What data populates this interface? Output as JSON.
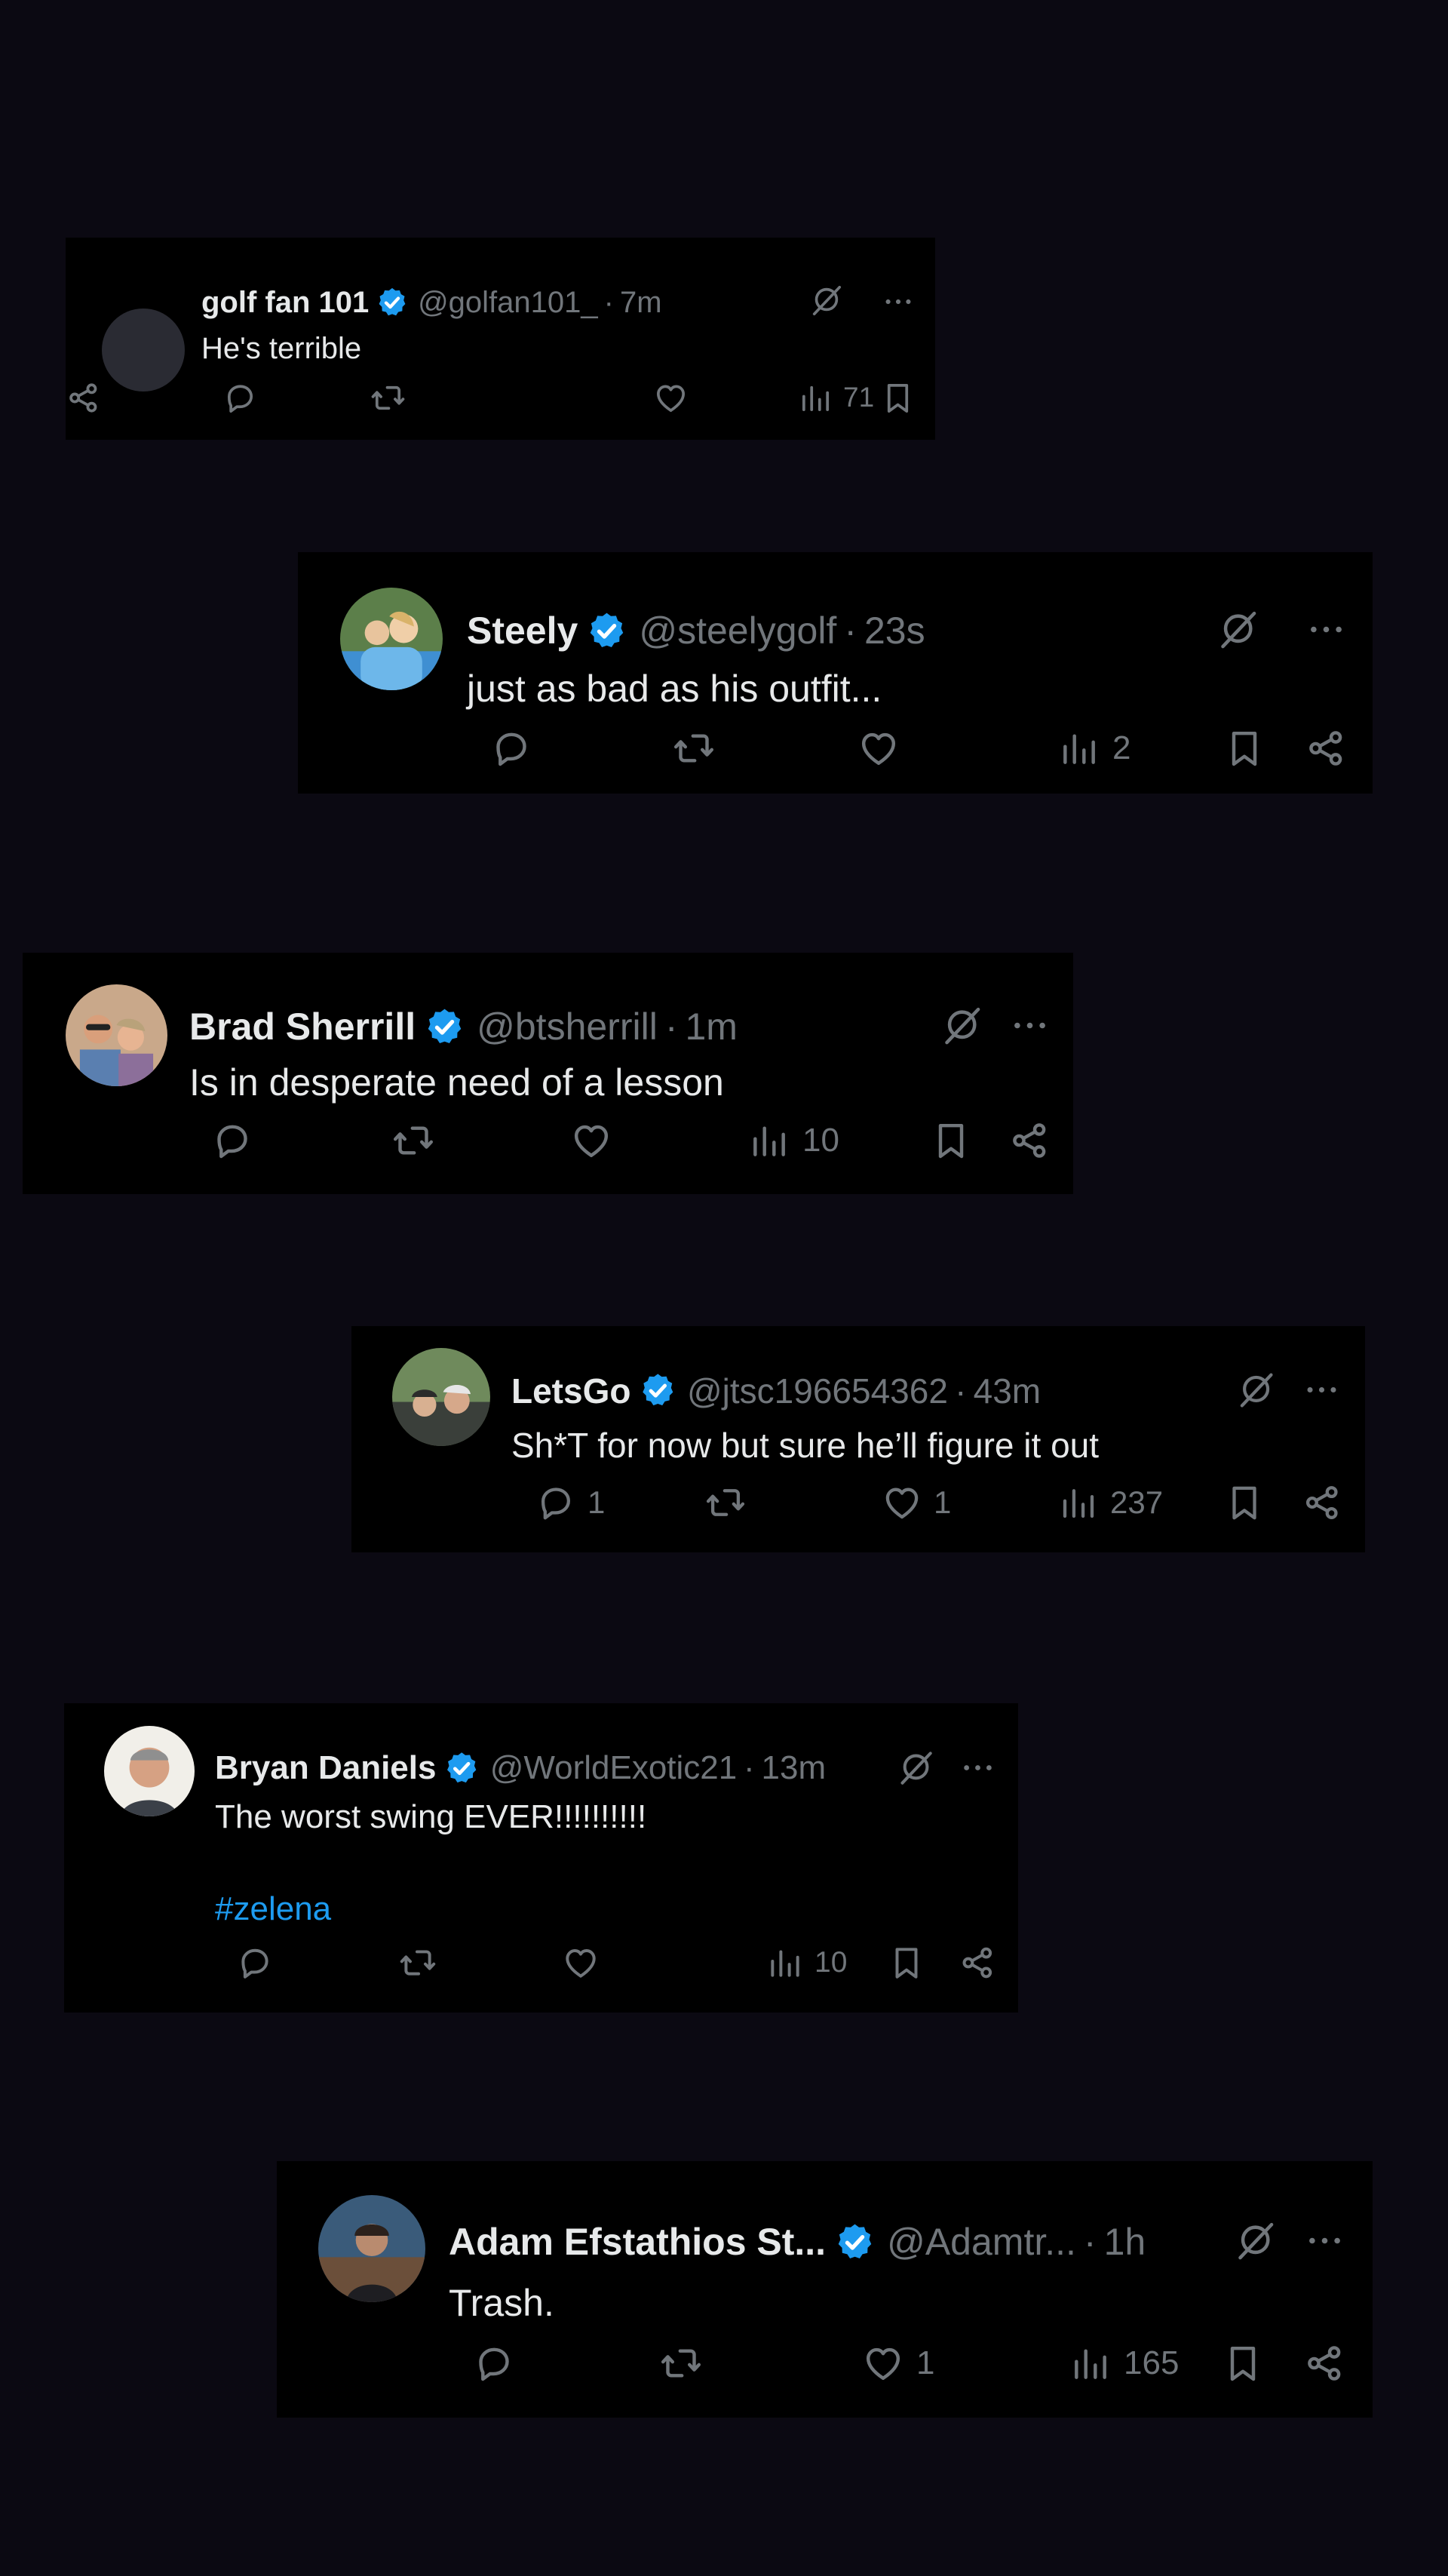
{
  "tweets": [
    {
      "name": "golf fan 101",
      "handle": "@golfan101_",
      "time": "7m",
      "text": "He's terrible",
      "hashtag": "",
      "replies": "",
      "likes": "",
      "views": "71"
    },
    {
      "name": "Steely",
      "handle": "@steelygolf",
      "time": "23s",
      "text": "just as bad as his outfit...",
      "hashtag": "",
      "replies": "",
      "likes": "",
      "views": "2"
    },
    {
      "name": "Brad Sherrill",
      "handle": "@btsherrill",
      "time": "1m",
      "text": "Is in desperate need of a lesson",
      "hashtag": "",
      "replies": "",
      "likes": "",
      "views": "10"
    },
    {
      "name": "LetsGo",
      "handle": "@jtsc196654362",
      "time": "43m",
      "text": "Sh*T for now but sure he’ll figure it out",
      "hashtag": "",
      "replies": "1",
      "likes": "1",
      "views": "237"
    },
    {
      "name": "Bryan Daniels",
      "handle": "@WorldExotic21",
      "time": "13m",
      "text": "The worst swing EVER!!!!!!!!!!",
      "hashtag": "#zelena",
      "replies": "",
      "likes": "",
      "views": "10"
    },
    {
      "name": "Adam Efstathios St...",
      "handle": "@Adamtr...",
      "time": "1h",
      "text": "Trash.",
      "hashtag": "",
      "replies": "",
      "likes": "1",
      "views": "165"
    }
  ],
  "separator": "·",
  "icons": {
    "verified": "verified-badge-icon",
    "topic": "grok-slash-icon",
    "more": "more-dots-icon",
    "reply": "reply-icon",
    "retweet": "retweet-icon",
    "like": "like-icon",
    "views": "views-icon",
    "bookmark": "bookmark-icon",
    "share": "share-icon"
  },
  "colors": {
    "background": "#0b0912",
    "card": "#000000",
    "verified": "#1d9bf0",
    "hashtag": "#1d9bf0",
    "muted": "#71767b",
    "text": "#e7e9ea"
  }
}
